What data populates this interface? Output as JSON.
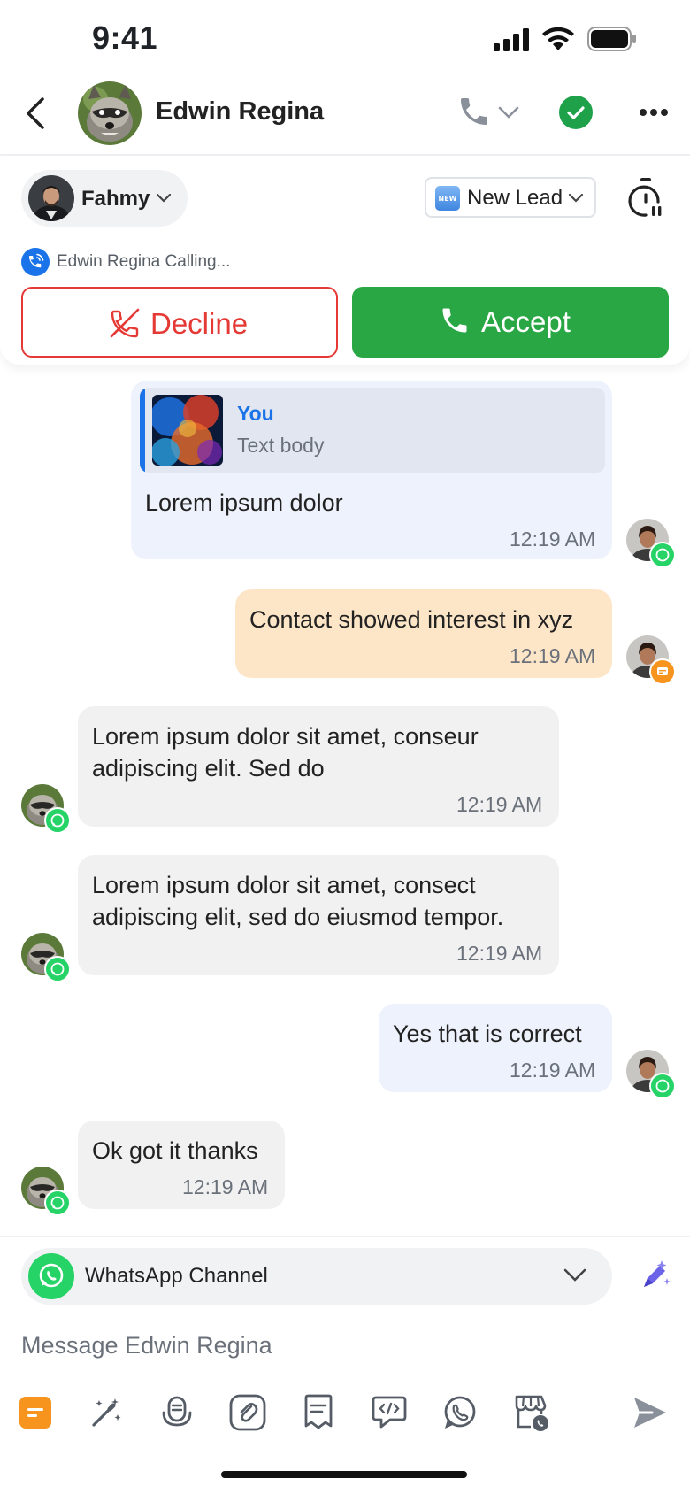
{
  "status_bar": {
    "time": "9:41"
  },
  "header": {
    "contact_name": "Edwin Regina",
    "icons": [
      "back-icon",
      "phone-icon",
      "chevron-down-icon",
      "check-circle-icon",
      "more-icon"
    ]
  },
  "call_panel": {
    "agent_name": "Fahmy",
    "lead_badge": "🆕",
    "lead_stage": "New Lead",
    "calling_text": "Edwin Regina Calling...",
    "decline_label": "Decline",
    "accept_label": "Accept"
  },
  "messages": [
    {
      "reply_author": "You",
      "reply_body": "Text body",
      "text": "Lorem ipsum dolor",
      "time": "12:19 AM",
      "side": "out",
      "channel": "whatsapp"
    },
    {
      "text": "Contact showed interest in xyz",
      "time": "12:19 AM",
      "side": "out",
      "channel": "note"
    },
    {
      "text_line1": "Lorem ipsum dolor sit amet, conseur",
      "text_line2": "adipiscing elit. Sed do",
      "time": "12:19 AM",
      "side": "in",
      "channel": "whatsapp"
    },
    {
      "text_line1": "Lorem ipsum dolor sit amet, consect",
      "text_line2": "adipiscing elit, sed do eiusmod tempor.",
      "time": "12:19 AM",
      "side": "in",
      "channel": "whatsapp"
    },
    {
      "text": "Yes that is correct",
      "time": "12:19 AM",
      "side": "out",
      "channel": "whatsapp"
    },
    {
      "text": "Ok got it thanks",
      "time": "12:19 AM",
      "side": "in",
      "channel": "whatsapp"
    }
  ],
  "composer": {
    "channel_label": "WhatsApp Channel",
    "placeholder": "Message Edwin Regina",
    "toolbar_icons": [
      "note-icon",
      "magic-wand-icon",
      "microphone-icon",
      "attachment-icon",
      "template-icon",
      "code-message-icon",
      "whatsapp-icon",
      "store-call-icon",
      "send-icon"
    ]
  },
  "colors": {
    "accept": "#2aa745",
    "decline": "#e53935",
    "outgoing_bubble": "#eef2fc",
    "note_bubble": "#fde6c8",
    "incoming_bubble": "#f1f1f2",
    "link_blue": "#1a73e8",
    "whatsapp": "#25d366",
    "note_orange": "#f7941d"
  }
}
